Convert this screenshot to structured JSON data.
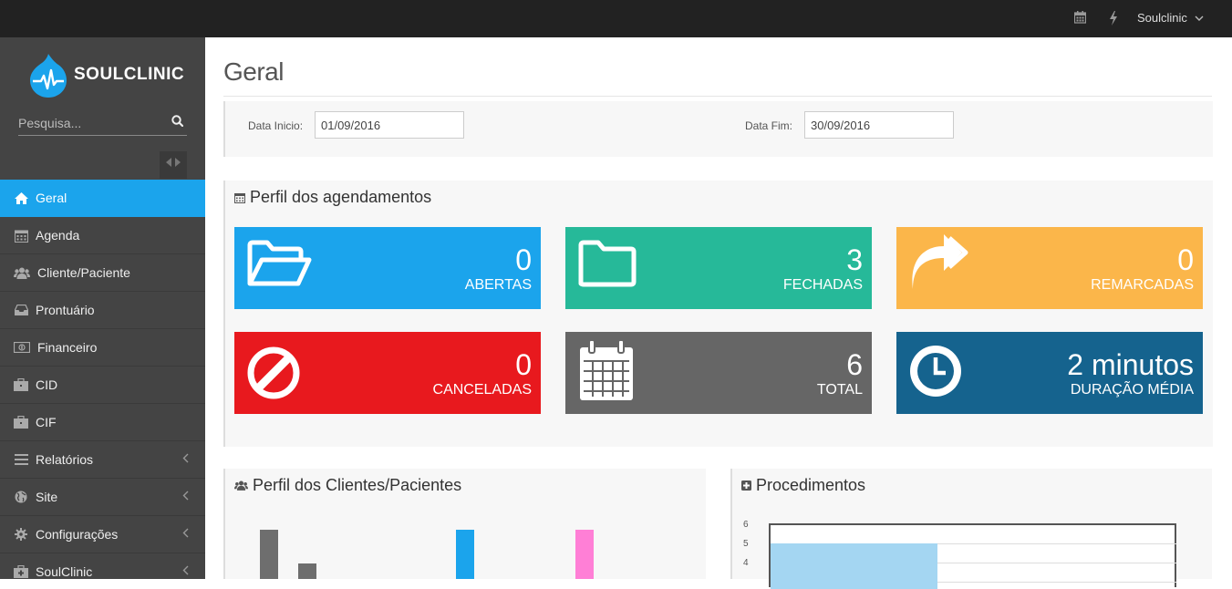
{
  "topbar": {
    "user_name": "Soulclinic",
    "icons": [
      "calendar-icon",
      "bolt-icon",
      "chevron-down-icon"
    ]
  },
  "sidebar": {
    "brand": "SOULCLINIC",
    "search_placeholder": "Pesquisa...",
    "items": [
      {
        "label": "Geral",
        "icon": "home-icon",
        "active": true
      },
      {
        "label": "Agenda",
        "icon": "calendar-icon"
      },
      {
        "label": "Cliente/Paciente",
        "icon": "users-icon"
      },
      {
        "label": "Prontuário",
        "icon": "inbox-icon"
      },
      {
        "label": "Financeiro",
        "icon": "money-icon"
      },
      {
        "label": "CID",
        "icon": "briefcase-icon"
      },
      {
        "label": "CIF",
        "icon": "briefcase-icon"
      },
      {
        "label": "Relatórios",
        "icon": "list-icon",
        "expandable": true
      },
      {
        "label": "Site",
        "icon": "globe-icon",
        "expandable": true
      },
      {
        "label": "Configurações",
        "icon": "gear-icon",
        "expandable": true
      },
      {
        "label": "SoulClinic",
        "icon": "medkit-icon",
        "expandable": true
      }
    ]
  },
  "main": {
    "title": "Geral",
    "filter": {
      "start_label": "Data Inicio:",
      "start_value": "01/09/2016",
      "end_label": "Data Fim:",
      "end_value": "30/09/2016"
    },
    "agendamentos": {
      "title": "Perfil dos agendamentos",
      "tiles": [
        {
          "value": "0",
          "label": "ABERTAS",
          "color": "#1ba4ec",
          "icon": "folder-open-icon"
        },
        {
          "value": "3",
          "label": "FECHADAS",
          "color": "#26b999",
          "icon": "folder-icon"
        },
        {
          "value": "0",
          "label": "REMARCADAS",
          "color": "#fbb64a",
          "icon": "reply-all-icon"
        },
        {
          "value": "0",
          "label": "CANCELADAS",
          "color": "#e8191e",
          "icon": "ban-icon"
        },
        {
          "value": "6",
          "label": "TOTAL",
          "color": "#666666",
          "icon": "calendar-icon"
        },
        {
          "value": "2 minutos",
          "label": "DURAÇÃO MÉDIA",
          "color": "#15638e",
          "icon": "clock-icon"
        }
      ]
    },
    "clientes": {
      "title": "Perfil dos Clientes/Pacientes"
    },
    "procedimentos": {
      "title": "Procedimentos",
      "y_ticks": [
        "6",
        "5",
        "4"
      ]
    }
  }
}
